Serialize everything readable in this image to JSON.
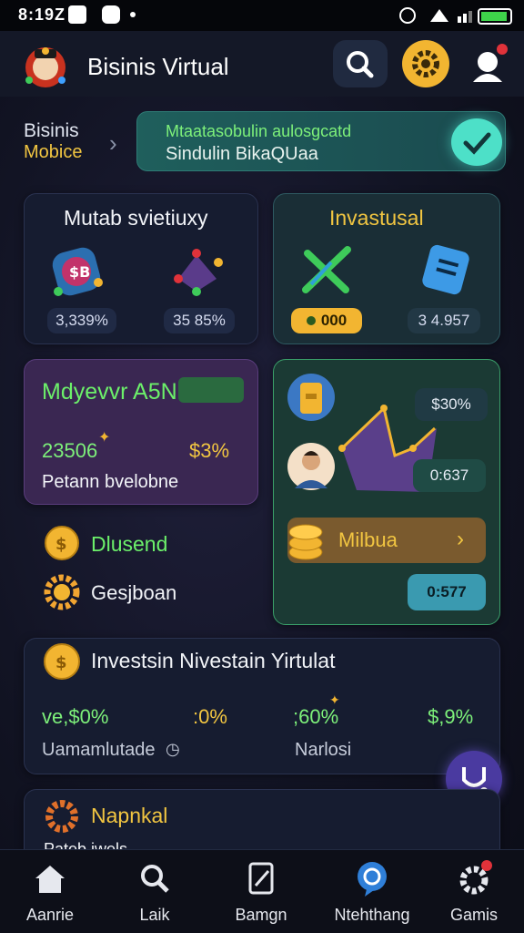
{
  "status_bar": {
    "time": "8:19Z"
  },
  "header": {
    "title": "Bisinis Virtual"
  },
  "breadcrumb": {
    "level1": "Bisinis",
    "level2": "Mobice"
  },
  "banner": {
    "line1": "Mtaatasobulin aulosgcatd",
    "line2": "Sindulin BikaQUaa"
  },
  "card_tl": {
    "title": "Mutab svietiuxy",
    "stat1": "3,339%",
    "stat2": "35 85%"
  },
  "card_tr": {
    "title": "Invastusal",
    "pill_left": "000",
    "stat_right": "3 4.957"
  },
  "card_ml": {
    "title": "Mdyevvr A5N",
    "value": "23506",
    "percent": "$3%",
    "subtitle": "Petann bvelobne"
  },
  "card_mr": {
    "badge_top": "$30%",
    "badge_mid": "0:637",
    "action_label": "Milbua",
    "badge_bottom": "0:577"
  },
  "list": {
    "item1": "Dlusend",
    "item2": "Gesjboan"
  },
  "invest": {
    "title": "Investsin Nivestain Yirtulat",
    "stats": [
      "ve,$0%",
      ":0%",
      ";60%",
      "$,9%"
    ],
    "label_left": "Uamamlutade",
    "label_right": "Narlosi"
  },
  "bottom_card": {
    "title": "Napnkal",
    "subtitle": "Pateb iwels"
  },
  "nav": {
    "items": [
      "Aanrie",
      "Laik",
      "Bamgn",
      "Ntehthang",
      "Gamis"
    ]
  },
  "colors": {
    "accent_green": "#7df07a",
    "gold": "#f2b531",
    "teal": "#4de0c8",
    "purple": "#4a2f68"
  }
}
